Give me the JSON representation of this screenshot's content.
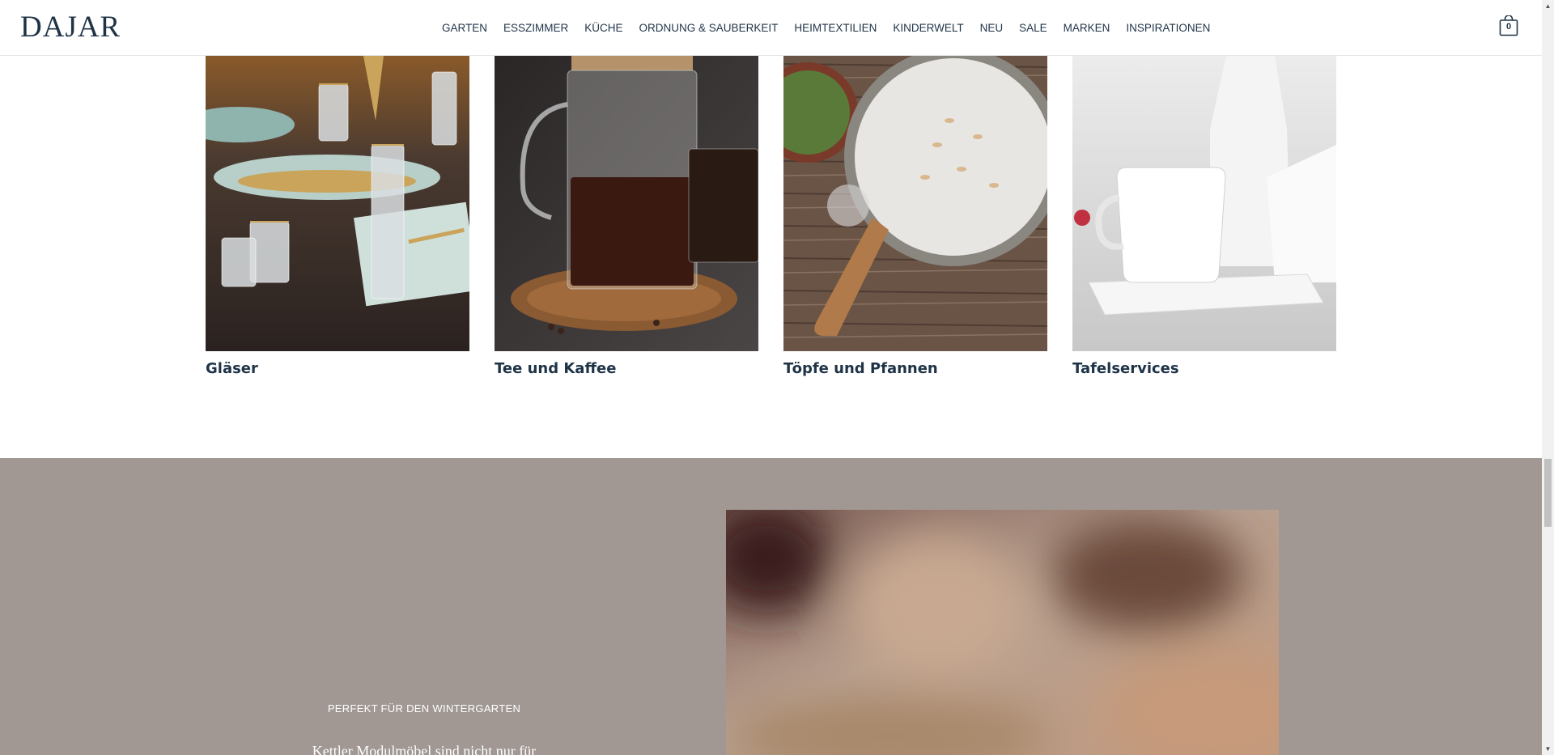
{
  "header": {
    "logo": "DAJAR",
    "nav": [
      "GARTEN",
      "ESSZIMMER",
      "KÜCHE",
      "ORDNUNG & SAUBERKEIT",
      "HEIMTEXTILIEN",
      "KINDERWELT",
      "NEU",
      "SALE",
      "MARKEN",
      "INSPIRATIONEN"
    ],
    "cart_count": "0"
  },
  "categories": [
    {
      "label": "Gläser"
    },
    {
      "label": "Tee und Kaffee"
    },
    {
      "label": "Töpfe und Pfannen"
    },
    {
      "label": "Tafelservices"
    }
  ],
  "promo": {
    "eyebrow": "PERFEKT FÜR DEN WINTERGARTEN",
    "text": "Kettler Modulmöbel sind nicht nur für"
  },
  "colors": {
    "brand": "#1f3347",
    "promo_bg": "#a19894"
  }
}
